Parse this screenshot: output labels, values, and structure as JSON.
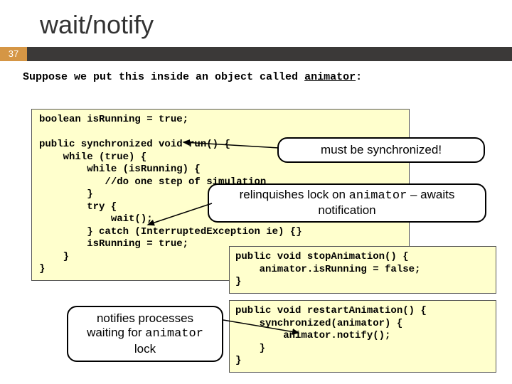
{
  "page_number": "37",
  "title": "wait/notify",
  "intro_prefix": "Suppose we put this inside an object called ",
  "intro_underlined": "animator",
  "intro_suffix": ":",
  "code_main": "boolean isRunning = true;\n\npublic synchronized void run() {\n    while (true) {\n        while (isRunning) {\n           //do one step of simulation\n        }\n        try {\n            wait();\n        } catch (InterruptedException ie) {}\n        isRunning = true;\n    }\n}",
  "code_stop": "public void stopAnimation() {\n    animator.isRunning = false;\n}",
  "code_restart": "public void restartAnimation() {\n    synchronized(animator) {\n        animator.notify();\n    }\n}",
  "callout_sync": "must be synchronized!",
  "callout_relinq_a": "relinquishes lock on ",
  "callout_relinq_mono": "animator",
  "callout_relinq_b": " – awaits notification",
  "callout_notify_a": "notifies processes waiting for ",
  "callout_notify_mono": "animator",
  "callout_notify_b": " lock"
}
